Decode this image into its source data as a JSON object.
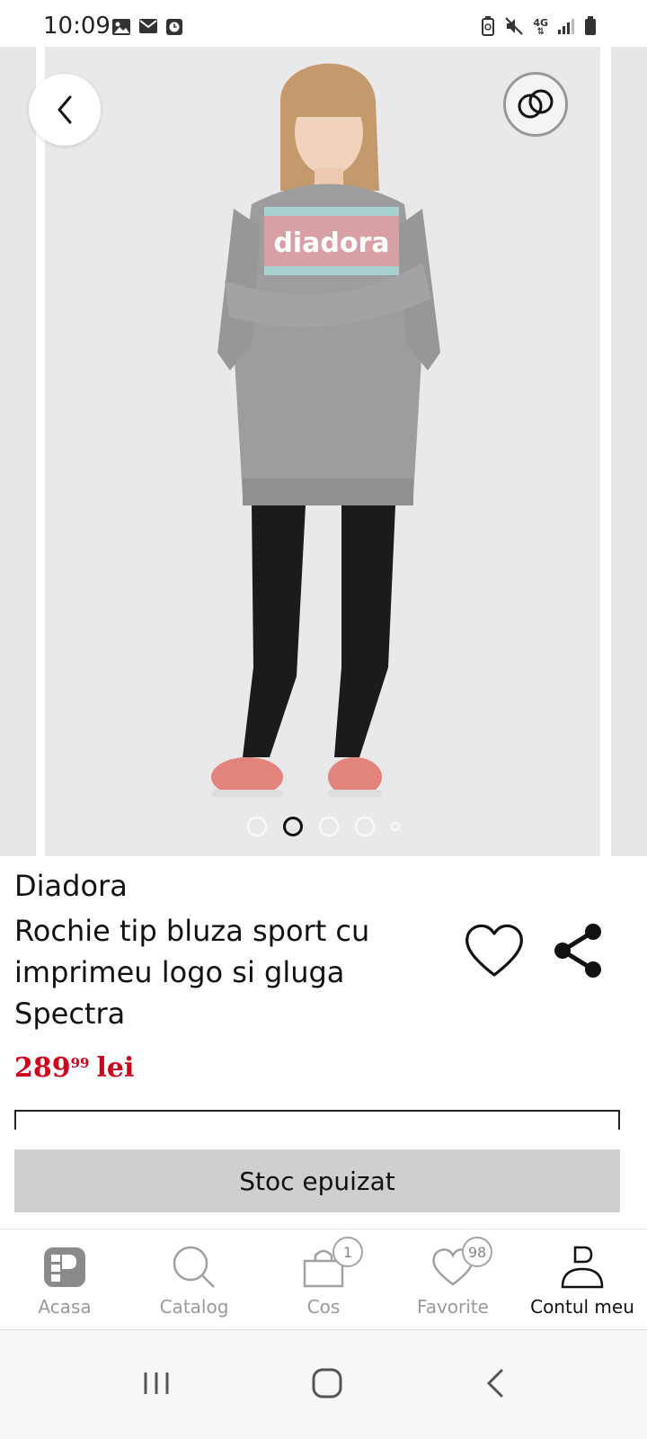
{
  "status_bar": {
    "time": "10:09",
    "left_icons": [
      "image-icon",
      "mail-icon",
      "clock-icon"
    ],
    "right_icons": [
      "battery-saver-icon",
      "mute-icon",
      "network-4g-icon",
      "signal-icon",
      "battery-icon"
    ],
    "network_label": "4G"
  },
  "gallery": {
    "image_alt": "product-photo",
    "dots_total": 5,
    "active_dot": 1
  },
  "product": {
    "brand": "Diadora",
    "title": "Rochie tip bluza sport cu imprimeu logo si gluga Spectra",
    "price_whole": "289",
    "price_decimal": "99",
    "currency": "lei",
    "price_color": "#d0021b"
  },
  "actions": {
    "stock_label": "Stoc epuizat"
  },
  "bottom_nav": {
    "items": [
      {
        "label": "Acasa",
        "icon": "home-logo-icon"
      },
      {
        "label": "Catalog",
        "icon": "search-icon"
      },
      {
        "label": "Cos",
        "icon": "cart-icon",
        "badge": "1"
      },
      {
        "label": "Favorite",
        "icon": "heart-icon",
        "badge": "98"
      },
      {
        "label": "Contul meu",
        "icon": "user-icon"
      }
    ],
    "active_index": 4
  }
}
